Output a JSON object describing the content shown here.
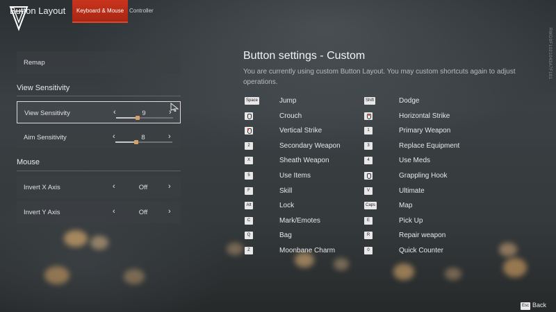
{
  "header": {
    "title": "Button Layout",
    "tabs": [
      {
        "label": "Keyboard & Mouse",
        "active": true
      },
      {
        "label": "Controller",
        "active": false
      }
    ],
    "side_id": "RWD9F1021043A7F101"
  },
  "left_panel": {
    "remap_label": "Remap",
    "view_section": "View Sensitivity",
    "view_sensitivity": {
      "label": "View Sensitivity",
      "value": "9",
      "level": 0.1
    },
    "aim_sensitivity": {
      "label": "Aim Sensitivity",
      "value": "8",
      "level": 0.08
    },
    "mouse_section": "Mouse",
    "invert_x": {
      "label": "Invert X Axis",
      "value": "Off"
    },
    "invert_y": {
      "label": "Invert Y Axis",
      "value": "Off"
    },
    "arrow_left": "‹",
    "arrow_right": "›"
  },
  "settings": {
    "title": "Button settings - Custom",
    "subtitle": "You are currently using custom Button Layout. You may custom shortcuts again to adjust operations.",
    "left_bindings": [
      {
        "key": "Space",
        "action": "Jump"
      },
      {
        "key": "",
        "icon": "mouse-left-icon",
        "action": "Crouch"
      },
      {
        "key": "",
        "icon": "mouse-left-click-icon",
        "action": "Vertical Strike"
      },
      {
        "key": "2",
        "action": "Secondary Weapon"
      },
      {
        "key": "X",
        "action": "Sheath Weapon"
      },
      {
        "key": "5",
        "action": "Use Items"
      },
      {
        "key": "F",
        "action": "Skill"
      },
      {
        "key": "Alt",
        "action": "Lock"
      },
      {
        "key": "C",
        "action": "Mark/Emotes"
      },
      {
        "key": "Q",
        "action": "Bag"
      },
      {
        "key": "Z",
        "action": "Moonbane Charm"
      }
    ],
    "right_bindings": [
      {
        "key": "Shift",
        "action": "Dodge"
      },
      {
        "key": "",
        "icon": "mouse-right-click-icon",
        "action": "Horizontal Strike"
      },
      {
        "key": "1",
        "action": "Primary Weapon"
      },
      {
        "key": "3",
        "action": "Replace Equipment"
      },
      {
        "key": "4",
        "action": "Use Meds"
      },
      {
        "key": "",
        "icon": "mouse-middle-icon",
        "action": "Grappling Hook"
      },
      {
        "key": "V",
        "action": "Ultimate"
      },
      {
        "key": "Caps",
        "action": "Map"
      },
      {
        "key": "E",
        "action": "Pick Up"
      },
      {
        "key": "R",
        "action": "Repair weapon"
      },
      {
        "key": "0",
        "action": "Quick Counter"
      }
    ]
  },
  "footer": {
    "back_key": "Esc",
    "back_label": "Back"
  },
  "colors": {
    "accent": "#c9341c",
    "knob": "#d6a066"
  }
}
